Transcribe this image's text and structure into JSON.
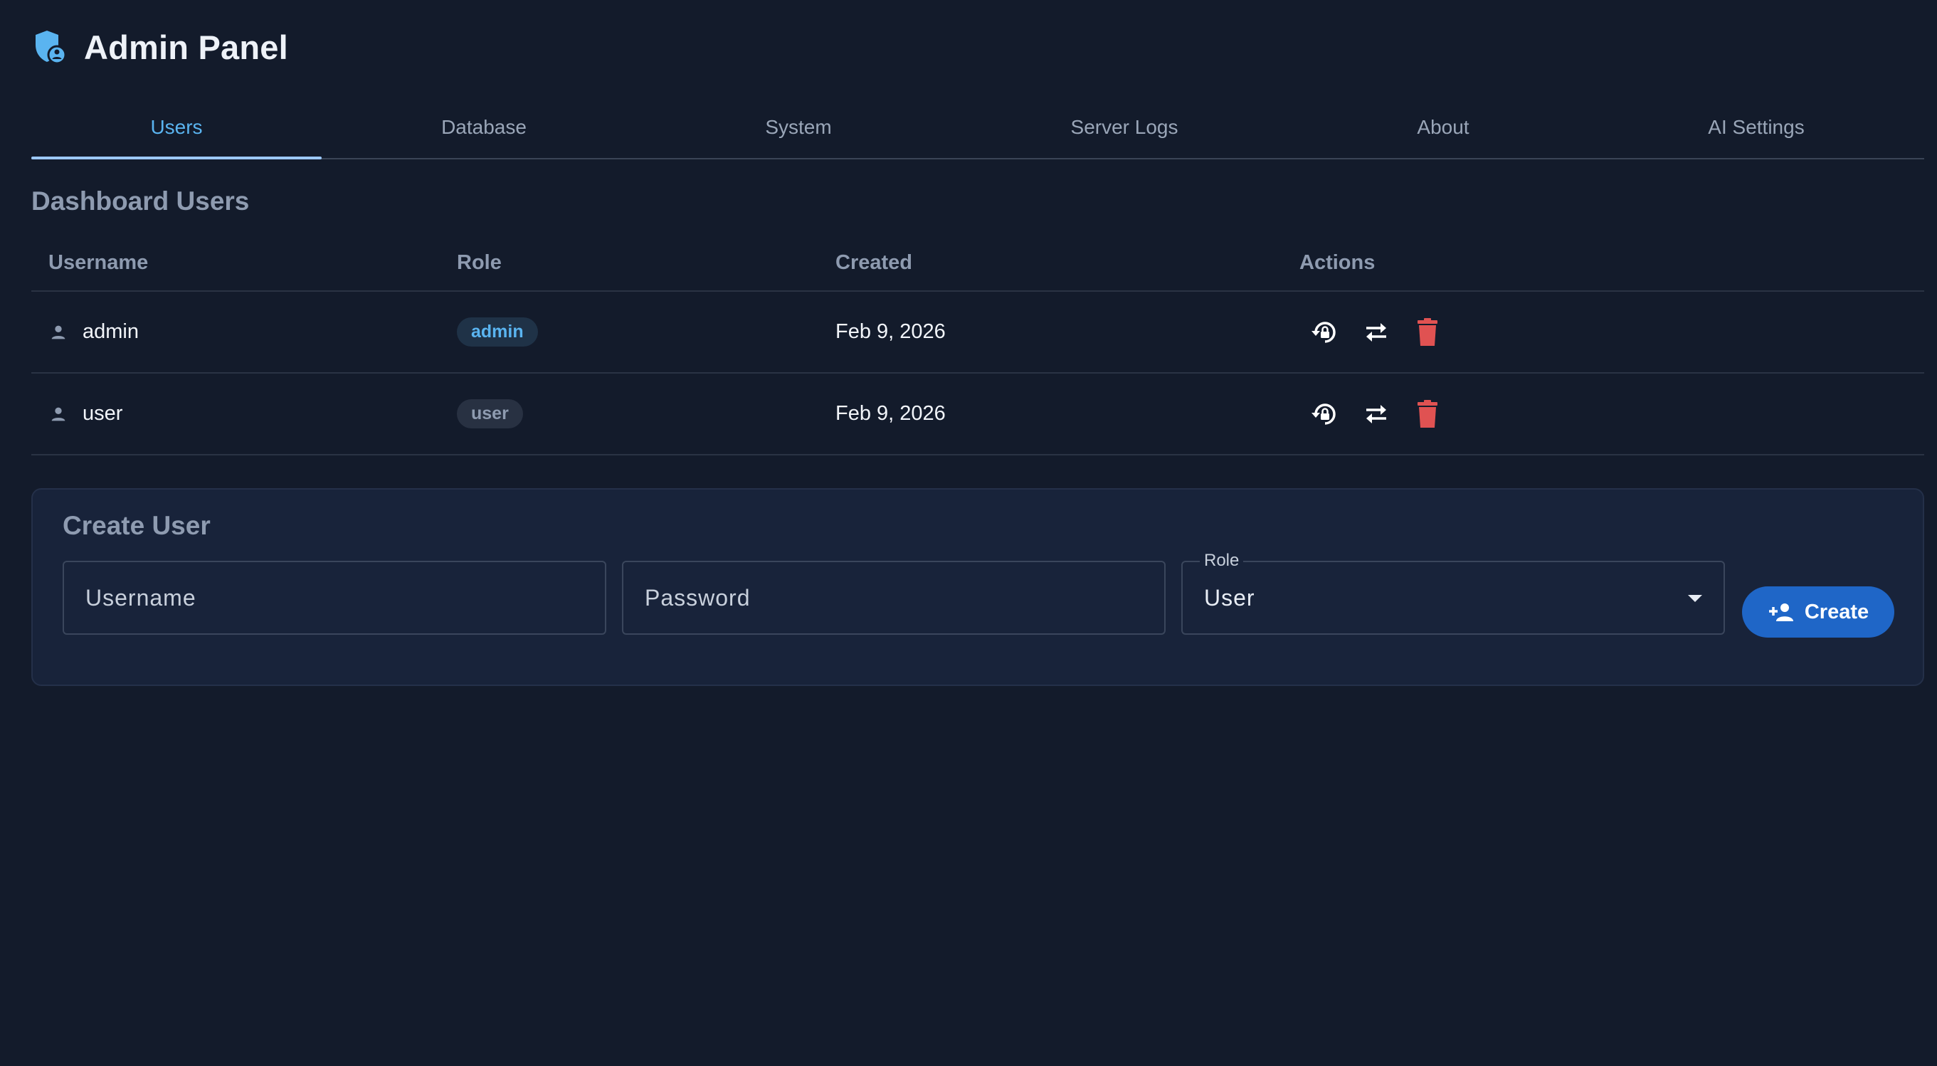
{
  "app": {
    "title": "Admin Panel",
    "logo_icon": "admin-shield-icon",
    "accent_color": "#5ab4f0"
  },
  "tabs": [
    {
      "label": "Users",
      "active": true
    },
    {
      "label": "Database",
      "active": false
    },
    {
      "label": "System",
      "active": false
    },
    {
      "label": "Server Logs",
      "active": false
    },
    {
      "label": "About",
      "active": false
    },
    {
      "label": "AI Settings",
      "active": false
    }
  ],
  "users_section": {
    "title": "Dashboard Users",
    "columns": {
      "username": "Username",
      "role": "Role",
      "created": "Created",
      "actions": "Actions"
    },
    "rows": [
      {
        "username": "admin",
        "role": "admin",
        "created": "Feb 9, 2026"
      },
      {
        "username": "user",
        "role": "user",
        "created": "Feb 9, 2026"
      }
    ],
    "action_icons": [
      "lock-reset-icon",
      "swap-role-icon",
      "delete-icon"
    ],
    "delete_color": "#e05252"
  },
  "create_user": {
    "title": "Create User",
    "username_placeholder": "Username",
    "password_placeholder": "Password",
    "role_label": "Role",
    "role_value": "User",
    "submit_label": "Create",
    "submit_icon": "person-add-icon",
    "button_color": "#1f66c7"
  }
}
